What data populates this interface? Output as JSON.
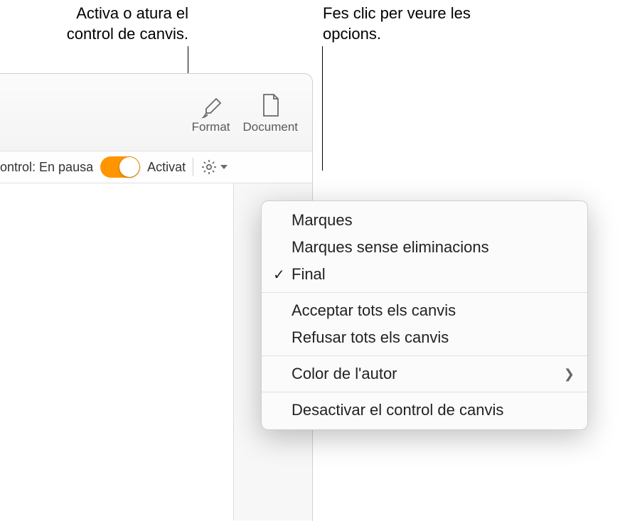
{
  "callouts": {
    "left": "Activa o atura el control de canvis.",
    "right": "Fes clic per veure les opcions."
  },
  "toolbar": {
    "format_label": "Format",
    "document_label": "Document"
  },
  "tracking": {
    "label_prefix": "ontrol: En pausa",
    "state_label": "Activat"
  },
  "icons": {
    "format": "brush-icon",
    "document": "document-icon",
    "gear": "gear-icon",
    "chevron": "chevron-down-icon"
  },
  "menu": {
    "items": [
      {
        "label": "Marques",
        "checked": false,
        "submenu": false
      },
      {
        "label": "Marques sense eliminacions",
        "checked": false,
        "submenu": false
      },
      {
        "label": "Final",
        "checked": true,
        "submenu": false
      }
    ],
    "group2": [
      {
        "label": "Acceptar tots els canvis",
        "checked": false,
        "submenu": false
      },
      {
        "label": "Refusar tots els canvis",
        "checked": false,
        "submenu": false
      }
    ],
    "group3": [
      {
        "label": "Color de l'autor",
        "checked": false,
        "submenu": true
      }
    ],
    "group4": [
      {
        "label": "Desactivar el control de canvis",
        "checked": false,
        "submenu": false
      }
    ]
  }
}
